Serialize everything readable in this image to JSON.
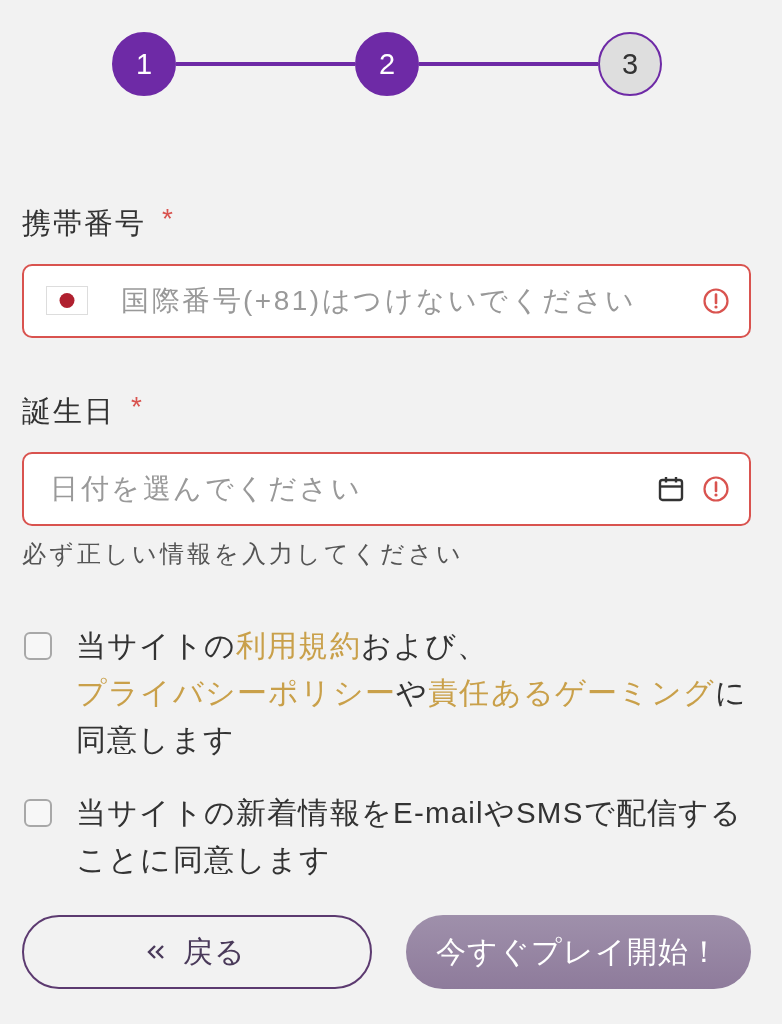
{
  "stepper": {
    "steps": [
      {
        "label": "1",
        "completed": true
      },
      {
        "label": "2",
        "completed": true
      },
      {
        "label": "3",
        "completed": false
      }
    ]
  },
  "fields": [
    {
      "kind": "phone",
      "label": "携帯番号",
      "required_mark": "*",
      "placeholder": "国際番号(+81)はつけないでください",
      "error": true
    },
    {
      "kind": "date",
      "label": "誕生日",
      "required_mark": "*",
      "placeholder": "日付を選んでください",
      "error": true,
      "helper": "必ず正しい情報を入力してください"
    }
  ],
  "consents": [
    {
      "checked": false,
      "segments": [
        {
          "kind": "text",
          "text": "当サイトの"
        },
        {
          "kind": "link",
          "text": "利用規約"
        },
        {
          "kind": "text",
          "text": "および、"
        },
        {
          "kind": "link",
          "text": "プライバシーポリシー"
        },
        {
          "kind": "text",
          "text": "や"
        },
        {
          "kind": "link",
          "text": "責任あるゲーミング"
        },
        {
          "kind": "text",
          "text": "に同意します"
        }
      ]
    },
    {
      "checked": false,
      "segments": [
        {
          "kind": "text",
          "text": "当サイトの新着情報をE-mailやSMSで配信することに同意します"
        }
      ]
    }
  ],
  "buttons": [
    {
      "kind": "back",
      "label": "戻る",
      "disabled": false
    },
    {
      "kind": "primary",
      "label": "今すぐプレイ開始！",
      "disabled": true
    }
  ]
}
